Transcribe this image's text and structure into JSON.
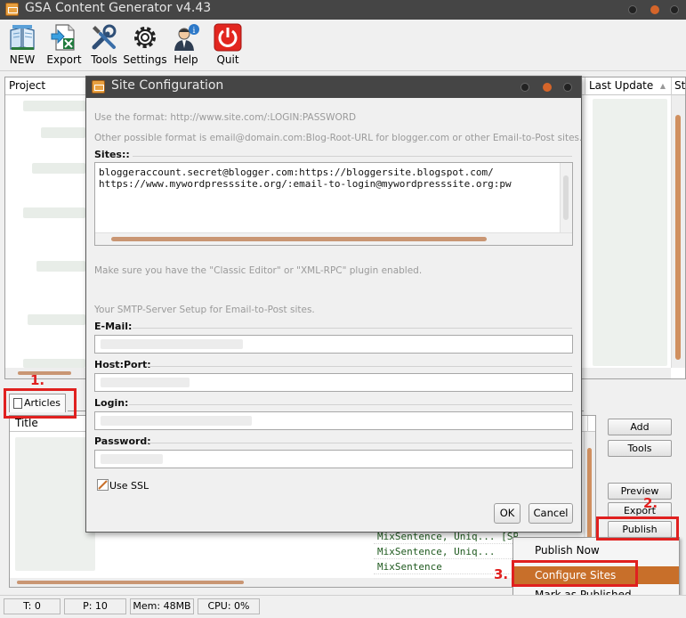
{
  "app": {
    "title": "GSA Content Generator v4.43"
  },
  "toolbar": {
    "items": [
      {
        "label": "NEW",
        "icon": "book-new-icon"
      },
      {
        "label": "Export",
        "icon": "export-sheet-icon"
      },
      {
        "label": "Tools",
        "icon": "tools-icon"
      },
      {
        "label": "Settings",
        "icon": "gear-icon"
      },
      {
        "label": "Help",
        "icon": "help-person-icon"
      },
      {
        "label": "Quit",
        "icon": "power-icon"
      }
    ]
  },
  "project_list": {
    "columns": [
      "Project",
      "Last Update",
      "St"
    ],
    "sort_glyph": "▲"
  },
  "articles": {
    "tab_label": "Articles",
    "column": "Title",
    "rows": [
      "MixSentence, Uniq...",
      "MixSentence, Uniq...",
      "MixSentence"
    ],
    "row_suffix": "[SPINT D-S"
  },
  "right_buttons": {
    "add": "Add",
    "tools": "Tools",
    "preview": "Preview",
    "export": "Export",
    "publish": "Publish"
  },
  "context_menu": {
    "items": [
      "Publish Now",
      "Configure Sites",
      "Mark as Published"
    ],
    "selected_index": 1
  },
  "status": {
    "t": "T: 0",
    "p": "P: 10",
    "mem": "Mem: 48MB",
    "cpu": "CPU: 0%"
  },
  "annotations": [
    "1.",
    "2.",
    "3."
  ],
  "dialog": {
    "title": "Site Configuration",
    "hint_format": "Use the format: http://www.site.com/:LOGIN:PASSWORD",
    "hint_email": "Other possible format is email@domain.com:Blog-Root-URL for blogger.com or other Email-to-Post sites.",
    "sites_label": "Sites::",
    "sites": [
      "bloggeraccount.secret@blogger.com:https://bloggersite.blogspot.com/",
      "https://www.mywordpresssite.org/:email-to-login@mywordpresssite.org:pw"
    ],
    "hint_plugin": "Make sure you have the \"Classic Editor\" or \"XML-RPC\" plugin enabled.",
    "hint_smtp": "Your SMTP-Server Setup for Email-to-Post sites.",
    "email_label": "E-Mail:",
    "host_label": "Host:Port:",
    "login_label": "Login:",
    "password_label": "Password:",
    "ssl_label": "Use SSL",
    "ssl_checked": true,
    "ok": "OK",
    "cancel": "Cancel"
  },
  "colors": {
    "titlebar": "#454545",
    "accent_orange": "#c86f2a",
    "annotation_red": "#e0201f"
  }
}
